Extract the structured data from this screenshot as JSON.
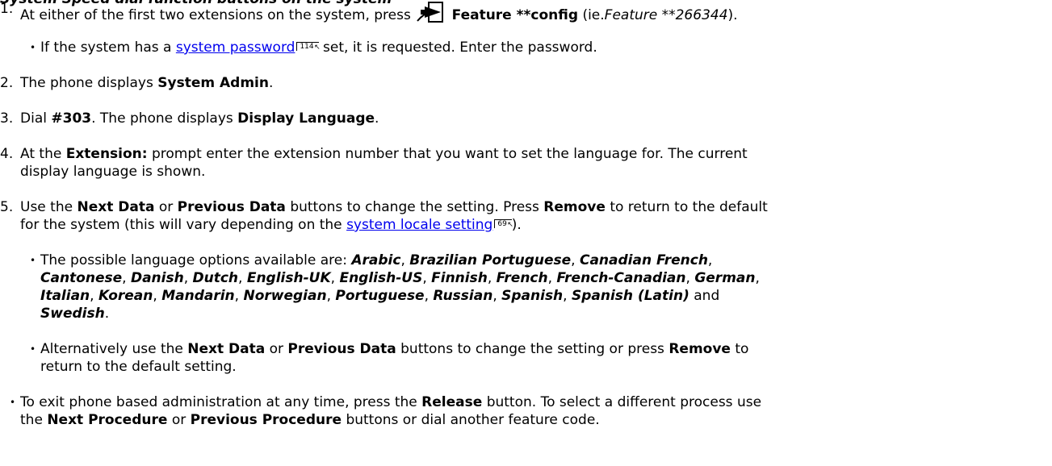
{
  "header_fragment": "System Speed dial function buttons on the system",
  "steps": {
    "s1": {
      "num": "1.",
      "pre": "At either of the first two extensions on the system, press",
      "bold": "Feature **config",
      "post": "(ie.",
      "example": "Feature **266344",
      "end": ")."
    },
    "s1b": {
      "pre": "If the system has a",
      "link": "system password",
      "ref": "114",
      "post": "set, it is requested. Enter the password."
    },
    "s2": {
      "num": "2.",
      "pre": "The phone displays",
      "bold": "System Admin",
      "end": "."
    },
    "s3": {
      "num": "3.",
      "pre": "Dial",
      "bold": "#303",
      "mid": ". The phone displays",
      "bold2": "Display Language",
      "end": "."
    },
    "s4": {
      "num": "4.",
      "pre": "At the",
      "bold": "Extension:",
      "post": "prompt enter the extension number that you want to set the language for. The current",
      "line2": "display language is shown."
    },
    "s5": {
      "num": "5.",
      "pre": "Use the",
      "b1": "Next Data",
      "t1": "or",
      "b2": "Previous Data",
      "t2": "buttons to change the setting. Press",
      "b3": "Remove",
      "t3": "to return to the default",
      "line2_pre": "for the system (this will vary depending on the",
      "link": "system locale setting",
      "ref": "69",
      "line2_end": ")."
    },
    "s5b": {
      "pre": "The possible language options available are:",
      "langs": [
        "Arabic",
        "Brazilian Portuguese",
        "Canadian French",
        "Cantonese",
        "Danish",
        "Dutch",
        "English-UK",
        "English-US",
        "Finnish",
        "French",
        "French-Canadian",
        "German",
        "Italian",
        "Korean",
        "Mandarin",
        "Norwegian",
        "Portuguese",
        "Russian",
        "Spanish",
        "Spanish (Latin)",
        "Swedish"
      ],
      "and": "and"
    },
    "s5c": {
      "pre": "Alternatively use the",
      "b1": "Next Data",
      "t1": "or",
      "b2": "Previous Data",
      "t2": "buttons to change the setting or press",
      "b3": "Remove",
      "t3": "to",
      "line2": "return to the default setting."
    },
    "note": {
      "pre": "To exit phone based administration at any time, press the",
      "b1": "Release",
      "t1": "button. To select a different process use",
      "line2_pre": "the",
      "b2": "Next Procedure",
      "t2": "or",
      "b3": "Previous Procedure",
      "t3": "buttons or dial another feature code."
    }
  },
  "icons": {
    "feature_key": "feature-arrow-icon"
  }
}
